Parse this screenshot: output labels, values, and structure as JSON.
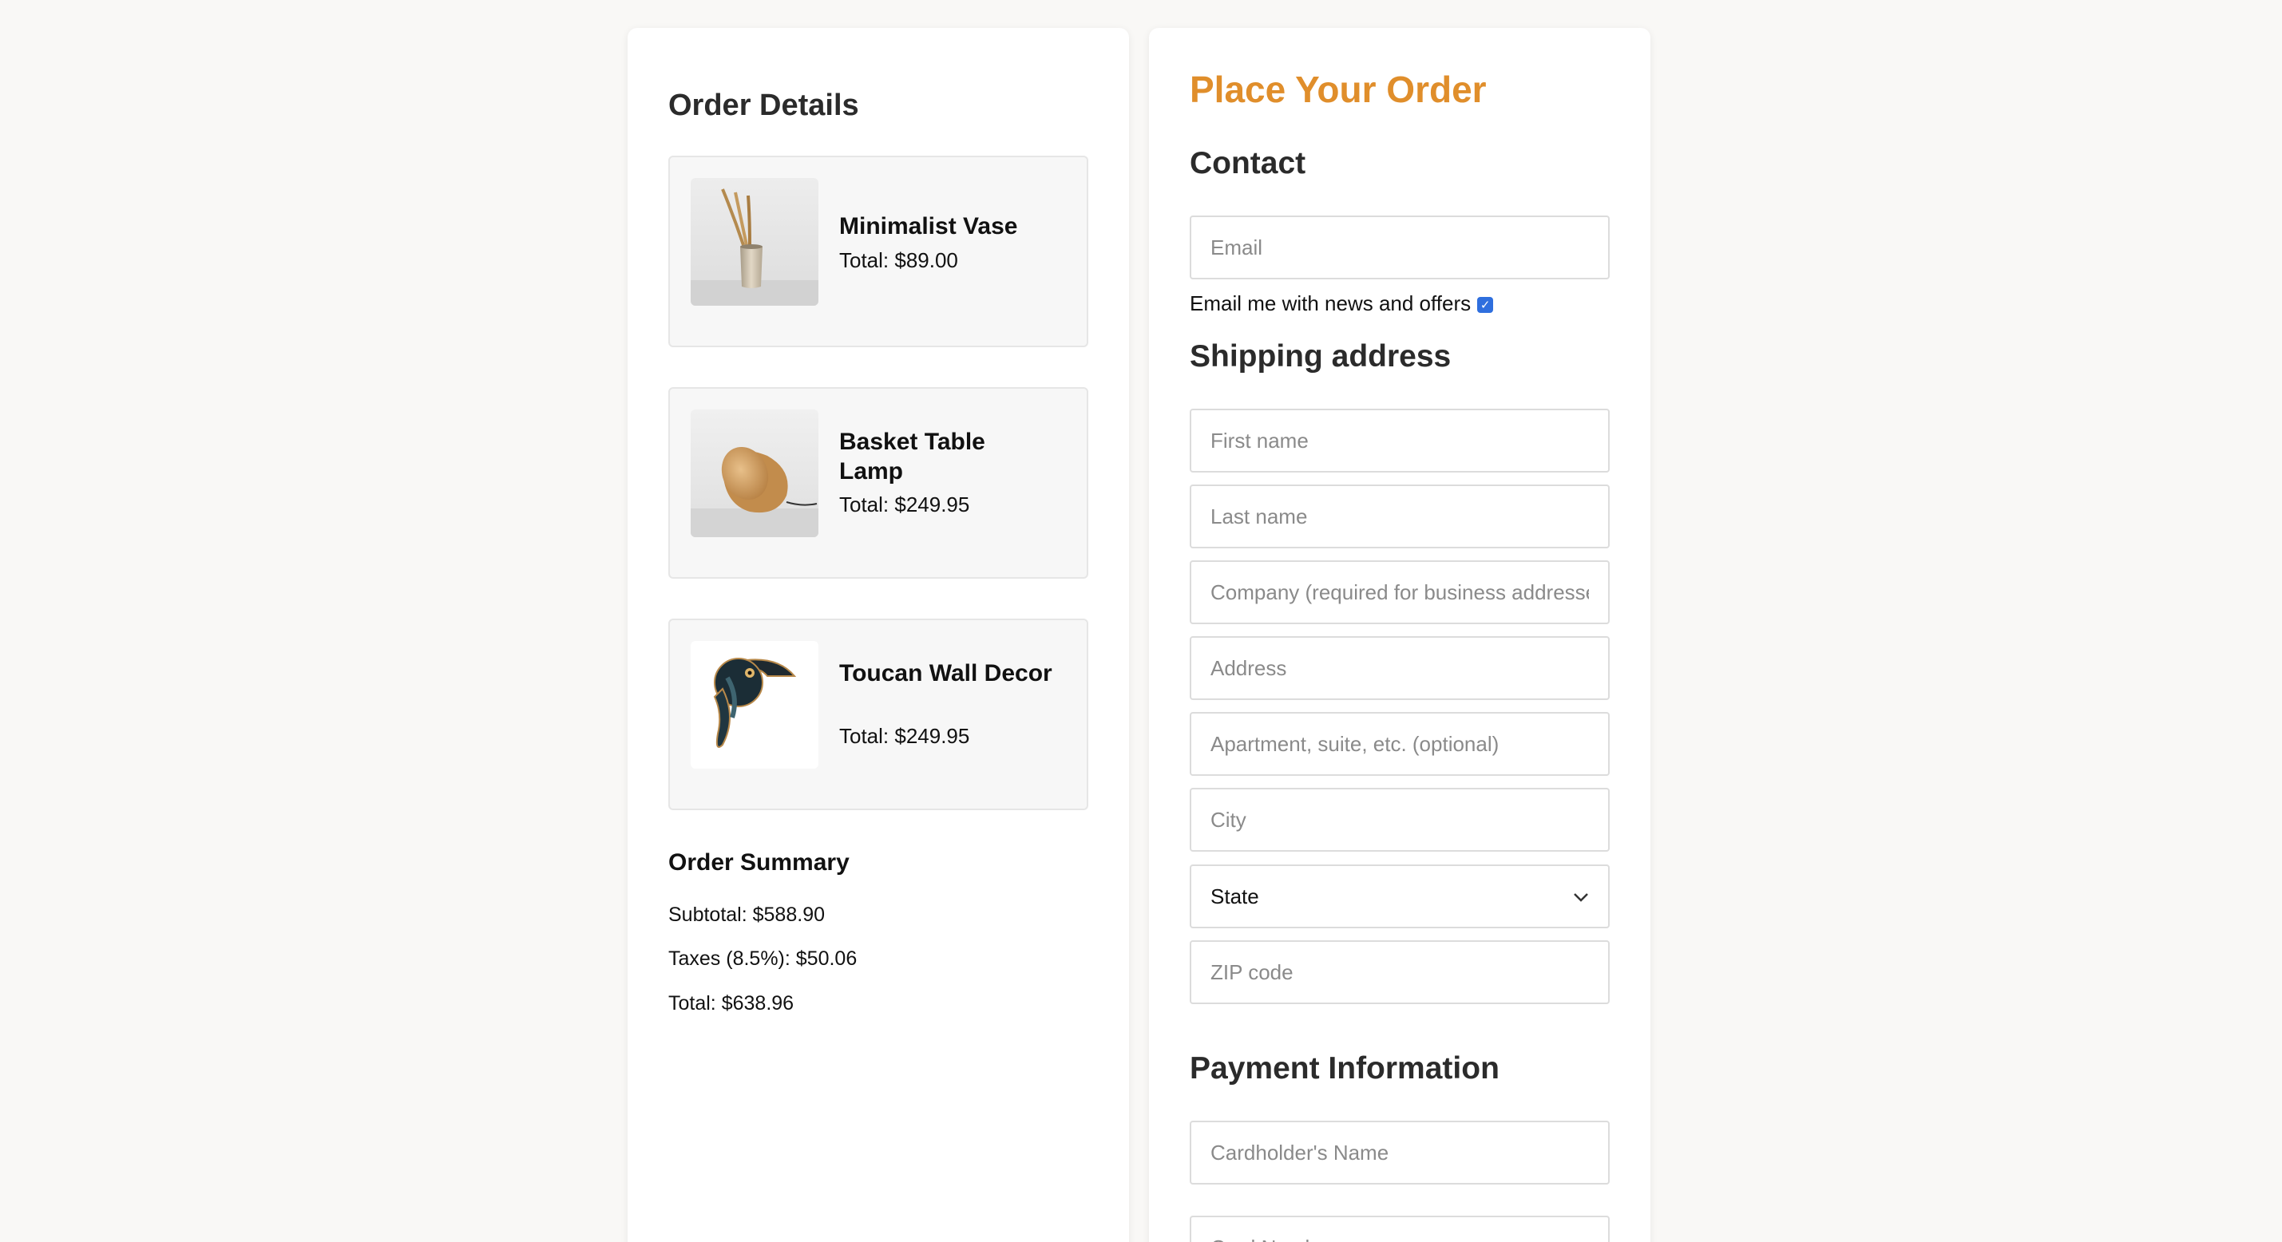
{
  "order_details": {
    "title": "Order Details",
    "items": [
      {
        "name": "Minimalist Vase",
        "total": "Total: $89.00"
      },
      {
        "name": "Basket Table Lamp",
        "total": "Total: $249.95"
      },
      {
        "name": "Toucan Wall Decor",
        "total": "Total: $249.95"
      }
    ],
    "summary": {
      "title": "Order Summary",
      "subtotal": "Subtotal: $588.90",
      "taxes": "Taxes (8.5%): $50.06",
      "total": "Total: $638.96"
    }
  },
  "checkout": {
    "title": "Place Your Order",
    "contact": {
      "heading": "Contact",
      "email_placeholder": "Email",
      "newsletter_label": "Email me with news and offers",
      "newsletter_checked": true
    },
    "shipping": {
      "heading": "Shipping address",
      "first_name_placeholder": "First name",
      "last_name_placeholder": "Last name",
      "company_placeholder": "Company (required for business addresses)",
      "address_placeholder": "Address",
      "apartment_placeholder": "Apartment, suite, etc. (optional)",
      "city_placeholder": "City",
      "state_value": "State",
      "zip_placeholder": "ZIP code"
    },
    "payment": {
      "heading": "Payment Information",
      "cardholder_placeholder": "Cardholder's Name",
      "card_number_placeholder": "Card Number"
    }
  },
  "colors": {
    "accent": "#e08e2b",
    "background": "#f9f8f6",
    "checkbox": "#2f6fde"
  },
  "icons": [
    "chevron-down-icon",
    "checkmark-icon"
  ]
}
